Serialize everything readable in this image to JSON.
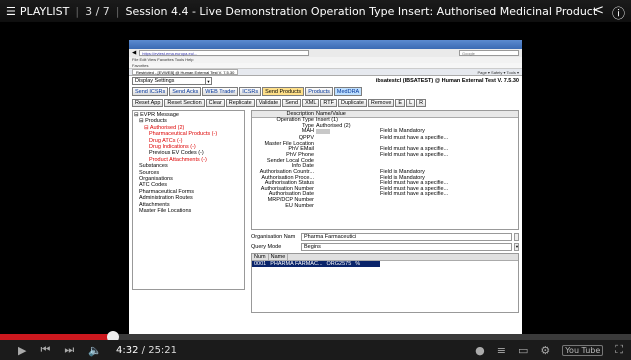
{
  "player": {
    "playlist_label": "PLAYLIST",
    "playlist_position": "3 / 7",
    "video_title": "Session 4.4 - Live Demonstration Operation Type Insert: Authorised Medicinal Product",
    "current_time": "4:32",
    "duration": "25:21",
    "progress_fraction": 0.179,
    "buffered_fraction": 0.18,
    "logo_text": "You Tube"
  },
  "browser": {
    "address": "https://evtest.ema.europa.eu/...",
    "search_placeholder": "Google",
    "menu": "File  Edit  View  Favorites  Tools  Help",
    "favorites": "Favorites",
    "tab_label": "Restricted - [EVWEB] @ Human External Test V. 7.5.30",
    "tools": "Page ▾  Safety ▾  Tools ▾",
    "status": "Local intranet   100% ▾"
  },
  "app": {
    "settings_dropdown": "Display Settings",
    "user_info": "ibsatestcl (IBSATEST) @ Human External Test V. 7.5.30",
    "main_tabs": [
      "Send ICSRs",
      "Send Acks",
      "WEB Trader",
      "ICSRs",
      "Send Products",
      "Products",
      "MedDRA"
    ],
    "action_buttons": [
      "Reset App",
      "Reset Section",
      "Clear",
      "Replicate",
      "Validate",
      "Send",
      "XML",
      "RTF",
      "Duplicate",
      "Remove",
      "E",
      "L",
      "R"
    ],
    "tree": [
      {
        "label": "⊟ EVPR Message",
        "indent": 0,
        "style": "normal"
      },
      {
        "label": "⊟ Products",
        "indent": 1,
        "style": "normal"
      },
      {
        "label": "⊟ Authorised (2)",
        "indent": 2,
        "style": "red"
      },
      {
        "label": "Pharmaceutical Products (-)",
        "indent": 3,
        "style": "red"
      },
      {
        "label": "Drug ATCs (-)",
        "indent": 3,
        "style": "red"
      },
      {
        "label": "Drug Indications (-)",
        "indent": 3,
        "style": "red"
      },
      {
        "label": "Previous EV Codes (-)",
        "indent": 3,
        "style": "normal"
      },
      {
        "label": "Product Attachments (-)",
        "indent": 3,
        "style": "red"
      },
      {
        "label": "Substances",
        "indent": 1,
        "style": "normal"
      },
      {
        "label": "Sources",
        "indent": 1,
        "style": "normal"
      },
      {
        "label": "Organisations",
        "indent": 1,
        "style": "normal"
      },
      {
        "label": "ATC Codes",
        "indent": 1,
        "style": "normal"
      },
      {
        "label": "Pharmaceutical Forms",
        "indent": 1,
        "style": "normal"
      },
      {
        "label": "Administration Routes",
        "indent": 1,
        "style": "normal"
      },
      {
        "label": "Attachments",
        "indent": 1,
        "style": "normal"
      },
      {
        "label": "Master File Locations",
        "indent": 1,
        "style": "normal"
      }
    ],
    "detail_header": [
      "Description",
      "Name/Value",
      ""
    ],
    "detail_rows": [
      {
        "label": "Operation Type",
        "value": "Insert (1)",
        "msg": ""
      },
      {
        "label": "Type",
        "value": "Authorised (2)",
        "msg": ""
      },
      {
        "label": "MAH",
        "value": "",
        "msg": "Field is Mandatory",
        "box": true
      },
      {
        "label": "QPPV",
        "value": "",
        "msg": "Field must have a specifie..."
      },
      {
        "label": "Master File Location",
        "value": "",
        "msg": ""
      },
      {
        "label": "PhV EMail",
        "value": "",
        "msg": "Field must have a specifie..."
      },
      {
        "label": "PhV Phone",
        "value": "",
        "msg": "Field must have a specifie..."
      },
      {
        "label": "Sender Local Code",
        "value": "",
        "msg": ""
      },
      {
        "label": "Info Date",
        "value": "",
        "msg": ""
      },
      {
        "label": "Authorisation Countr...",
        "value": "",
        "msg": "Field is Mandatory"
      },
      {
        "label": "Authorisation Proce...",
        "value": "",
        "msg": "Field is Mandatory"
      },
      {
        "label": "Authorisation Status",
        "value": "",
        "msg": "Field must have a specifie..."
      },
      {
        "label": "Authorisation Number",
        "value": "",
        "msg": "Field must have a specifie..."
      },
      {
        "label": "Authorisation Date",
        "value": "",
        "msg": "Field must have a specifie..."
      },
      {
        "label": "MRP/DCP Number",
        "value": "",
        "msg": ""
      },
      {
        "label": "EU Number",
        "value": "",
        "msg": ""
      }
    ],
    "org_label": "Organisation Nam",
    "org_value": "Pharma Farmaceutici",
    "query_label": "Query Mode",
    "query_value": "Begins",
    "results_header": [
      "Num",
      "Name"
    ],
    "results_rows": [
      {
        "num": "0001",
        "name": "PHARMA FARMAC...",
        "code": "ORG2575",
        "extra": "%"
      }
    ]
  },
  "colors": {
    "accent_red": "#cc181e",
    "selection_blue": "#0a246a",
    "tree_red": "#dd0000"
  }
}
